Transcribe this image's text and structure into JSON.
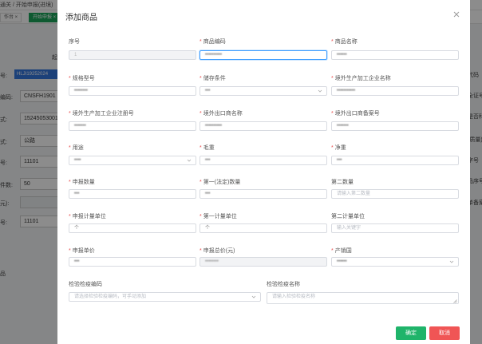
{
  "background": {
    "breadcrumb": "通关 / 开始申报(进境)",
    "tabs": [
      {
        "label": "作台 ×",
        "active": false
      },
      {
        "label": "开始申报 ×",
        "active": true
      }
    ],
    "rows": [
      {
        "label": "号:",
        "value": ""
      },
      {
        "label": "编码:",
        "value": "CNSFH1901"
      },
      {
        "label": "式:",
        "value": "15245053001"
      },
      {
        "label": "式:",
        "value": "公路"
      },
      {
        "label": "号:",
        "value": "11101"
      },
      {
        "label": "件数:",
        "value": "50"
      },
      {
        "label": "元):",
        "value": ""
      },
      {
        "label": "号:",
        "value": "11101"
      }
    ],
    "blue_tag": "HLJI19252024",
    "left_extra": "起",
    "left_bottom": "品",
    "right_labels": [
      "代码",
      "全证号",
      "是否科",
      "(质量)",
      "字号",
      "品序号",
      "单备案"
    ]
  },
  "modal": {
    "title": "添加商品",
    "ok_label": "确定",
    "cancel_label": "取消",
    "fields": [
      {
        "label": "序号",
        "required": false,
        "value": "1",
        "placeholder": "",
        "kind": "disabled"
      },
      {
        "label": "商品编码",
        "required": true,
        "value": "••••••••••",
        "placeholder": "",
        "kind": "focused"
      },
      {
        "label": "商品名称",
        "required": true,
        "value": "••••••",
        "placeholder": "",
        "kind": "text"
      },
      {
        "label": "规格型号",
        "required": true,
        "value": "••••••••",
        "placeholder": "",
        "kind": "text"
      },
      {
        "label": "储存条件",
        "required": true,
        "value": "•••",
        "placeholder": "",
        "kind": "select"
      },
      {
        "label": "境外生产加工企业名称",
        "required": true,
        "value": "•••••••••••",
        "placeholder": "",
        "kind": "text"
      },
      {
        "label": "境外生产加工企业注册号",
        "required": true,
        "value": "•••••••",
        "placeholder": "",
        "kind": "text"
      },
      {
        "label": "境外出口商名称",
        "required": true,
        "value": "••••••••••",
        "placeholder": "",
        "kind": "text"
      },
      {
        "label": "境外出口商备案号",
        "required": true,
        "value": "•••••••",
        "placeholder": "",
        "kind": "text"
      },
      {
        "label": "用途",
        "required": true,
        "value": "••••",
        "placeholder": "",
        "kind": "select"
      },
      {
        "label": "毛重",
        "required": true,
        "value": "•••",
        "placeholder": "",
        "kind": "text"
      },
      {
        "label": "净重",
        "required": true,
        "value": "•••",
        "placeholder": "",
        "kind": "text"
      },
      {
        "label": "申报数量",
        "required": true,
        "value": "•••",
        "placeholder": "",
        "kind": "text"
      },
      {
        "label": "第一(法定)数量",
        "required": true,
        "value": "•••",
        "placeholder": "",
        "kind": "text"
      },
      {
        "label": "第二数量",
        "required": false,
        "value": "",
        "placeholder": "请输入第二数量",
        "kind": "text"
      },
      {
        "label": "申报计量单位",
        "required": true,
        "value": "个",
        "placeholder": "",
        "kind": "text"
      },
      {
        "label": "第一计量单位",
        "required": true,
        "value": "个",
        "placeholder": "",
        "kind": "text"
      },
      {
        "label": "第二计量单位",
        "required": false,
        "value": "",
        "placeholder": "输入关键字",
        "kind": "text"
      },
      {
        "label": "申报单价",
        "required": true,
        "value": "•••",
        "placeholder": "",
        "kind": "text"
      },
      {
        "label": "申报总价(元)",
        "required": true,
        "value": "••••••••",
        "placeholder": "",
        "kind": "disabled"
      },
      {
        "label": "产销国",
        "required": true,
        "value": "••••••",
        "placeholder": "",
        "kind": "select"
      },
      {
        "label": "检验检疫编码",
        "required": false,
        "value": "",
        "placeholder": "请选择检验检疫编码，可手动添加",
        "kind": "select"
      },
      {
        "label": "检验检疫名称",
        "required": false,
        "value": "",
        "placeholder": "请输入检验检疫名称",
        "kind": "textarea"
      }
    ]
  }
}
